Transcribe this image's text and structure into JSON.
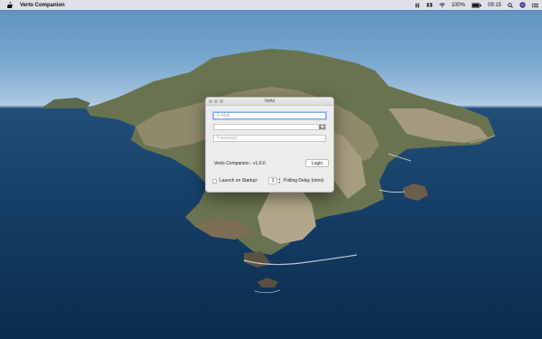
{
  "menubar": {
    "app_name": "Verto Companion",
    "battery": "100%",
    "time": "09:15",
    "icons": [
      "apple-icon",
      "verto-status-icon",
      "dropbox-icon",
      "wifi-icon",
      "battery-icon",
      "search-icon",
      "siri-icon",
      "notification-center-icon"
    ]
  },
  "window": {
    "title": "Verto",
    "email_placeholder": "E-Mail",
    "password_placeholder": "Password",
    "version_text": "Verto Companion - v1.0.0",
    "login_label": "Login",
    "launch_label": "Launch on Startup:",
    "polling_value": "1",
    "polling_label": "Polling Delay (mins)"
  },
  "colors": {
    "focus_ring": "#7eaef3",
    "sea_dark": "#0b2c4d",
    "sky": "#79a8cf"
  }
}
